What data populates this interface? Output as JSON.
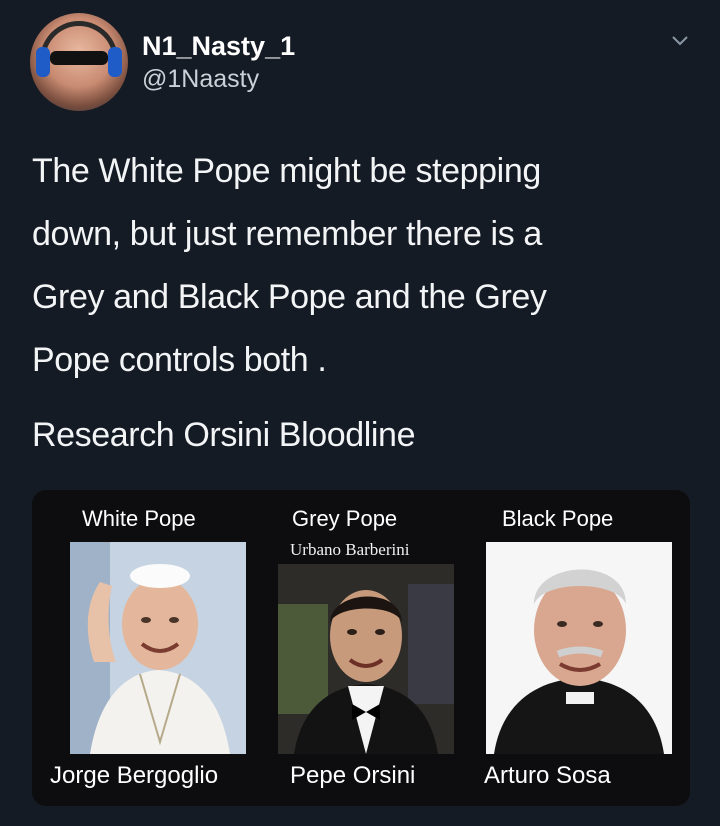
{
  "tweet": {
    "display_name": "N1_Nasty_1",
    "handle": "@1Naasty",
    "body_lines": [
      "The White Pope might be stepping",
      "down, but just remember there is a",
      "Grey and Black Pope and the Grey",
      "Pope controls both ."
    ],
    "body_second_paragraph": "Research Orsini Bloodline",
    "icons": {
      "menu": "chevron-down-icon",
      "avatar": "avatar"
    }
  },
  "media": {
    "columns": [
      {
        "title": "White Pope",
        "subtitle": "",
        "name": "Jorge Bergoglio"
      },
      {
        "title": "Grey Pope",
        "subtitle": "Urbano Barberini",
        "name": "Pepe Orsini"
      },
      {
        "title": "Black Pope",
        "subtitle": "",
        "name": "Arturo Sosa"
      }
    ]
  },
  "colors": {
    "background": "#151b24",
    "text": "#f2f4f6",
    "secondary_text": "#c9d1d9",
    "media_background": "#0d0d0f"
  }
}
